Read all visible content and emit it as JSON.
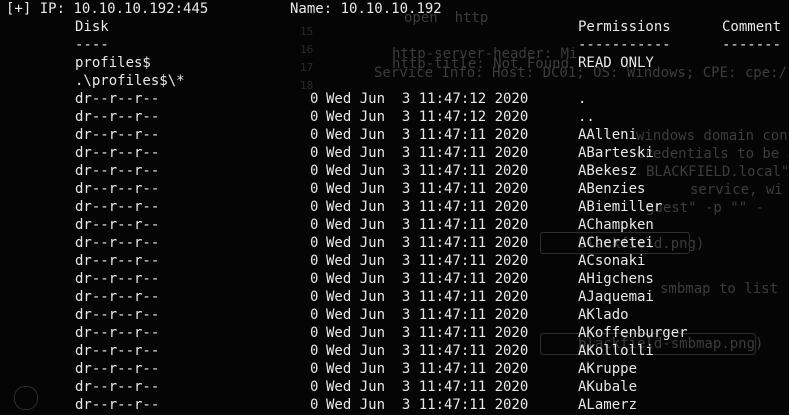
{
  "header": {
    "prefix": "[+]",
    "ip_label": "IP:",
    "ip_value": "10.10.10.192:445",
    "name_label": "Name:",
    "name_value": "10.10.10.192"
  },
  "table": {
    "col_disk": "Disk",
    "col_permissions": "Permissions",
    "col_comment": "Comment",
    "sep_disk": "----",
    "sep_permissions": "-----------",
    "sep_comment": "-------"
  },
  "share": {
    "name": "profiles$",
    "permission": "READ ONLY",
    "listing_path": ".\\profiles$\\*"
  },
  "entries": [
    {
      "attrs": "dr--r--r--",
      "size": "0",
      "date": "Wed Jun  3 11:47:12 2020",
      "name": "."
    },
    {
      "attrs": "dr--r--r--",
      "size": "0",
      "date": "Wed Jun  3 11:47:12 2020",
      "name": ".."
    },
    {
      "attrs": "dr--r--r--",
      "size": "0",
      "date": "Wed Jun  3 11:47:11 2020",
      "name": "AAlleni"
    },
    {
      "attrs": "dr--r--r--",
      "size": "0",
      "date": "Wed Jun  3 11:47:11 2020",
      "name": "ABarteski"
    },
    {
      "attrs": "dr--r--r--",
      "size": "0",
      "date": "Wed Jun  3 11:47:11 2020",
      "name": "ABekesz"
    },
    {
      "attrs": "dr--r--r--",
      "size": "0",
      "date": "Wed Jun  3 11:47:11 2020",
      "name": "ABenzies"
    },
    {
      "attrs": "dr--r--r--",
      "size": "0",
      "date": "Wed Jun  3 11:47:11 2020",
      "name": "ABiemiller"
    },
    {
      "attrs": "dr--r--r--",
      "size": "0",
      "date": "Wed Jun  3 11:47:11 2020",
      "name": "AChampken"
    },
    {
      "attrs": "dr--r--r--",
      "size": "0",
      "date": "Wed Jun  3 11:47:11 2020",
      "name": "ACheretei"
    },
    {
      "attrs": "dr--r--r--",
      "size": "0",
      "date": "Wed Jun  3 11:47:11 2020",
      "name": "ACsonaki"
    },
    {
      "attrs": "dr--r--r--",
      "size": "0",
      "date": "Wed Jun  3 11:47:11 2020",
      "name": "AHigchens"
    },
    {
      "attrs": "dr--r--r--",
      "size": "0",
      "date": "Wed Jun  3 11:47:11 2020",
      "name": "AJaquemai"
    },
    {
      "attrs": "dr--r--r--",
      "size": "0",
      "date": "Wed Jun  3 11:47:11 2020",
      "name": "AKlado"
    },
    {
      "attrs": "dr--r--r--",
      "size": "0",
      "date": "Wed Jun  3 11:47:11 2020",
      "name": "AKoffenburger"
    },
    {
      "attrs": "dr--r--r--",
      "size": "0",
      "date": "Wed Jun  3 11:47:11 2020",
      "name": "AKollolli"
    },
    {
      "attrs": "dr--r--r--",
      "size": "0",
      "date": "Wed Jun  3 11:47:11 2020",
      "name": "AKruppe"
    },
    {
      "attrs": "dr--r--r--",
      "size": "0",
      "date": "Wed Jun  3 11:47:11 2020",
      "name": "AKubale"
    },
    {
      "attrs": "dr--r--r--",
      "size": "0",
      "date": "Wed Jun  3 11:47:11 2020",
      "name": "ALamerz"
    }
  ],
  "background_ghost": {
    "lines": [
      "open  http",
      "http-server-header: Mi",
      "http-title: Not Found",
      "Service Info: Host: DC01; OS: Windows; CPE: cpe:/",
      "windows domain contro",
      "credentials to be able",
      "BLACKFIELD.local\", s",
      "service, wi",
      "guest\" -p \"\" -",
      "blackfield.png)",
      "smbmap to list",
      "blackfield-smbmap.png)"
    ],
    "numbers": [
      "15",
      "16",
      "17",
      "18"
    ]
  },
  "colors": {
    "background": "#050505",
    "foreground": "#e8e8e8",
    "ghost_text": "#3c3c3c"
  }
}
